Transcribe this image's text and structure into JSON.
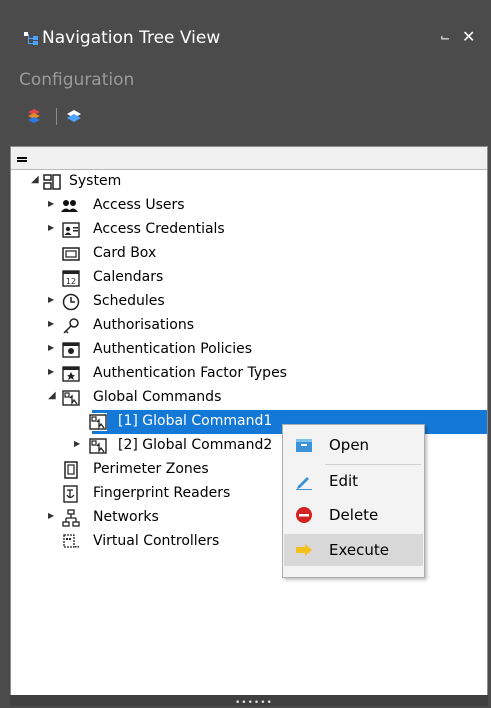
{
  "window": {
    "title": "Navigation Tree View",
    "subtitle": "Configuration",
    "pin_glyph": "⌙",
    "close_glyph": "✕"
  },
  "tree": {
    "items": [
      {
        "label": "System",
        "icon": "system-icon",
        "expander": "expanded"
      },
      {
        "label": "Access Users",
        "icon": "users-icon",
        "expander": "collapsed"
      },
      {
        "label": "Access Credentials",
        "icon": "credentials-icon",
        "expander": "collapsed"
      },
      {
        "label": "Card Box",
        "icon": "card-box-icon",
        "expander": "none"
      },
      {
        "label": "Calendars",
        "icon": "calendar-icon",
        "expander": "none"
      },
      {
        "label": "Schedules",
        "icon": "clock-icon",
        "expander": "collapsed"
      },
      {
        "label": "Authorisations",
        "icon": "key-icon",
        "expander": "collapsed"
      },
      {
        "label": "Authentication Policies",
        "icon": "policy-icon",
        "expander": "collapsed"
      },
      {
        "label": "Authentication Factor Types",
        "icon": "factor-icon",
        "expander": "collapsed"
      },
      {
        "label": "Global Commands",
        "icon": "global-command-icon",
        "expander": "expanded"
      },
      {
        "label": "[1] Global Command1",
        "icon": "global-command-icon",
        "expander": "collapsed",
        "selected": true
      },
      {
        "label": "[2] Global Command2",
        "icon": "global-command-icon",
        "expander": "collapsed"
      },
      {
        "label": "Perimeter Zones",
        "icon": "zone-icon",
        "expander": "none"
      },
      {
        "label": "Fingerprint Readers",
        "icon": "fingerprint-icon",
        "expander": "none"
      },
      {
        "label": "Networks",
        "icon": "network-icon",
        "expander": "collapsed"
      },
      {
        "label": "Virtual Controllers",
        "icon": "controller-icon",
        "expander": "none"
      }
    ]
  },
  "context_menu": {
    "items": [
      {
        "label": "Open",
        "icon": "folder-icon"
      },
      {
        "label": "Edit",
        "icon": "pencil-icon"
      },
      {
        "label": "Delete",
        "icon": "delete-icon"
      },
      {
        "label": "Execute",
        "icon": "arrow-right-icon",
        "highlighted": true
      }
    ]
  },
  "footer": {
    "grip": "••••••"
  },
  "colors": {
    "panel_bg": "#4b4b4b",
    "selection": "#1478d7",
    "menu_bg": "#f3f3f3",
    "delete_red": "#d32020",
    "execute_yellow": "#f2c21b"
  }
}
